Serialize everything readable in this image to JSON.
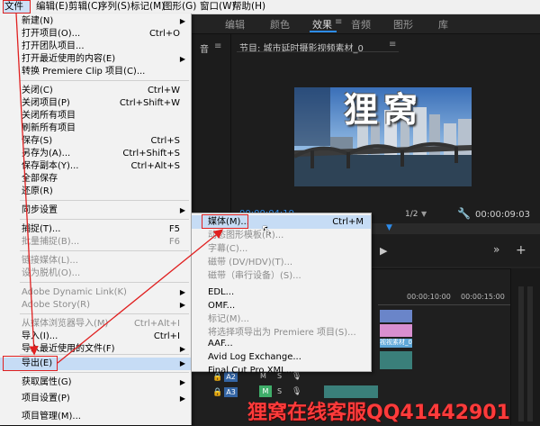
{
  "menubar": {
    "items": [
      "文件(F)",
      "编辑(E)",
      "剪辑(C)",
      "序列(S)",
      "标记(M)",
      "图形(G)",
      "窗口(W)",
      "帮助(H)"
    ]
  },
  "workspace_tabs": [
    "编辑",
    "颜色",
    "效果",
    "音频",
    "图形",
    "库"
  ],
  "program_monitor": {
    "title": "节目: 城市延时摄影视频素材_0",
    "overlay_text": "狸窝",
    "timecode_left": "00:00:04:19",
    "zoom": "1/2",
    "timecode_right": "00:00:09:03"
  },
  "timeline": {
    "ruler": [
      "00:00:10:00",
      "00:00:15:00"
    ],
    "clip_label": "视视素材_0.m",
    "track_a2": "A2",
    "track_a3": "A3",
    "m": "M",
    "s": "S"
  },
  "file_menu": {
    "items": [
      {
        "label": "新建(N)",
        "shortcut": "",
        "arrow": "▶",
        "disabled": false
      },
      {
        "label": "打开项目(O)...",
        "shortcut": "Ctrl+O",
        "arrow": "",
        "disabled": false
      },
      {
        "label": "打开团队项目...",
        "shortcut": "",
        "arrow": "",
        "disabled": false
      },
      {
        "label": "打开最近使用的内容(E)",
        "shortcut": "",
        "arrow": "▶",
        "disabled": false
      },
      {
        "label": "转换 Premiere Clip 项目(C)...",
        "shortcut": "",
        "arrow": "",
        "disabled": false
      },
      {
        "label": "关闭(C)",
        "shortcut": "Ctrl+W",
        "arrow": "",
        "disabled": false
      },
      {
        "label": "关闭项目(P)",
        "shortcut": "Ctrl+Shift+W",
        "arrow": "",
        "disabled": false
      },
      {
        "label": "关闭所有项目",
        "shortcut": "",
        "arrow": "",
        "disabled": false
      },
      {
        "label": "刷新所有项目",
        "shortcut": "",
        "arrow": "",
        "disabled": false
      },
      {
        "label": "保存(S)",
        "shortcut": "Ctrl+S",
        "arrow": "",
        "disabled": false
      },
      {
        "label": "另存为(A)...",
        "shortcut": "Ctrl+Shift+S",
        "arrow": "",
        "disabled": false
      },
      {
        "label": "保存副本(Y)...",
        "shortcut": "Ctrl+Alt+S",
        "arrow": "",
        "disabled": false
      },
      {
        "label": "全部保存",
        "shortcut": "",
        "arrow": "",
        "disabled": false
      },
      {
        "label": "还原(R)",
        "shortcut": "",
        "arrow": "",
        "disabled": false
      },
      {
        "label": "同步设置",
        "shortcut": "",
        "arrow": "▶",
        "disabled": false
      },
      {
        "label": "捕捉(T)...",
        "shortcut": "F5",
        "arrow": "",
        "disabled": false
      },
      {
        "label": "批量捕捉(B)...",
        "shortcut": "F6",
        "arrow": "",
        "disabled": true
      },
      {
        "label": "链接媒体(L)...",
        "shortcut": "",
        "arrow": "",
        "disabled": true
      },
      {
        "label": "设为脱机(O)...",
        "shortcut": "",
        "arrow": "",
        "disabled": true
      },
      {
        "label": "Adobe Dynamic Link(K)",
        "shortcut": "",
        "arrow": "▶",
        "disabled": true
      },
      {
        "label": "Adobe Story(R)",
        "shortcut": "",
        "arrow": "▶",
        "disabled": true
      },
      {
        "label": "从媒体浏览器导入(M)",
        "shortcut": "Ctrl+Alt+I",
        "arrow": "",
        "disabled": true
      },
      {
        "label": "导入(I)...",
        "shortcut": "Ctrl+I",
        "arrow": "",
        "disabled": false
      },
      {
        "label": "导入最近使用的文件(F)",
        "shortcut": "",
        "arrow": "▶",
        "disabled": false
      },
      {
        "label": "导出(E)",
        "shortcut": "",
        "arrow": "▶",
        "disabled": false
      },
      {
        "label": "获取属性(G)",
        "shortcut": "",
        "arrow": "▶",
        "disabled": false
      },
      {
        "label": "项目设置(P)",
        "shortcut": "",
        "arrow": "▶",
        "disabled": false
      },
      {
        "label": "项目管理(M)...",
        "shortcut": "",
        "arrow": "",
        "disabled": false
      }
    ]
  },
  "export_submenu": {
    "items": [
      {
        "label": "媒体(M)...",
        "shortcut": "Ctrl+M",
        "disabled": false
      },
      {
        "label": "动态图形模板(R)...",
        "shortcut": "",
        "disabled": true
      },
      {
        "label": "字幕(C)...",
        "shortcut": "",
        "disabled": true
      },
      {
        "label": "磁带 (DV/HDV)(T)...",
        "shortcut": "",
        "disabled": true
      },
      {
        "label": "磁带（串行设备）(S)...",
        "shortcut": "",
        "disabled": true
      },
      {
        "label": "EDL...",
        "shortcut": "",
        "disabled": false
      },
      {
        "label": "OMF...",
        "shortcut": "",
        "disabled": false
      },
      {
        "label": "标记(M)...",
        "shortcut": "",
        "disabled": true
      },
      {
        "label": "将选择项导出为 Premiere 项目(S)...",
        "shortcut": "",
        "disabled": true
      },
      {
        "label": "AAF...",
        "shortcut": "",
        "disabled": false
      },
      {
        "label": "Avid Log Exchange...",
        "shortcut": "",
        "disabled": false
      },
      {
        "label": "Final Cut Pro XML...",
        "shortcut": "",
        "disabled": false
      }
    ]
  },
  "watermark": "狸窝在线客服QQ41442901",
  "colors": {
    "annotation_red": "#e02020",
    "highlight": "#c6dcf5",
    "watermark": "#ff3b3b"
  }
}
